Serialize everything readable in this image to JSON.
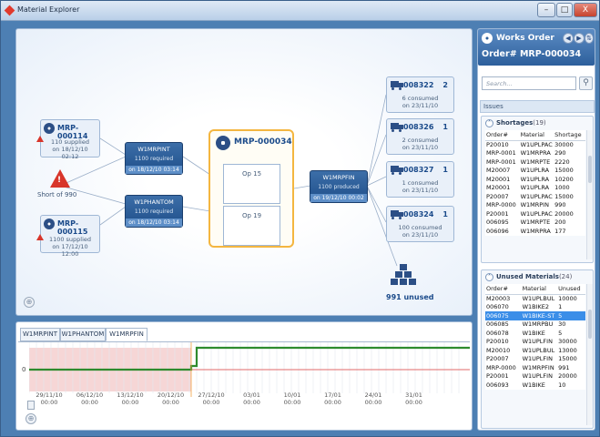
{
  "window": {
    "title": "Material Explorer",
    "buttons": [
      "–",
      "□",
      "X"
    ]
  },
  "graph": {
    "supplies": [
      {
        "id": "MRP-000114",
        "line1": "110 supplied",
        "line2": "on 18/12/10 02:12"
      },
      {
        "id": "MRP-000115",
        "line1": "1100 supplied",
        "line2": "on 17/12/10 12:00"
      }
    ],
    "shortage_label": "Short of 990",
    "requirements": [
      {
        "name": "W1MRPINT",
        "line1": "1100 required",
        "line2": "on 18/12/10 03:14"
      },
      {
        "name": "W1PHANTOM",
        "line1": "1100 required",
        "line2": "on 18/12/10 03:14"
      }
    ],
    "order": {
      "id": "MRP-000034",
      "ops": [
        "Op 15",
        "Op 19"
      ]
    },
    "produced": {
      "name": "W1MRPFIN",
      "line1": "1100 produced",
      "line2": "on 19/12/10 00:02"
    },
    "consumers": [
      {
        "id": "008322",
        "count": "2",
        "line1": "6 consumed",
        "line2": "on 23/11/10"
      },
      {
        "id": "008326",
        "count": "1",
        "line1": "2 consumed",
        "line2": "on 23/11/10"
      },
      {
        "id": "008327",
        "count": "1",
        "line1": "1 consumed",
        "line2": "on 23/11/10"
      },
      {
        "id": "008324",
        "count": "1",
        "line1": "100 consumed",
        "line2": "on 23/11/10"
      }
    ],
    "unused_label": "991 unused"
  },
  "timeline": {
    "tabs": [
      "W1MRPINT",
      "W1PHANTOM",
      "W1MRPFIN"
    ],
    "active_tab": "W1MRPFIN",
    "y_label": "0",
    "x_ticks": [
      [
        "29/11/10",
        "00:00"
      ],
      [
        "06/12/10",
        "00:00"
      ],
      [
        "13/12/10",
        "00:00"
      ],
      [
        "20/12/10",
        "00:00"
      ],
      [
        "27/12/10",
        "00:00"
      ],
      [
        "03/01",
        "00:00"
      ],
      [
        "10/01",
        "00:00"
      ],
      [
        "17/01",
        "00:00"
      ],
      [
        "24/01",
        "00:00"
      ],
      [
        "31/01",
        "00:00"
      ]
    ],
    "colors": {
      "shortage_fill": "#f6d6d6",
      "stock_line": "#2e8b2e",
      "shortage_line": "#e06a6a"
    }
  },
  "sidebar": {
    "title": "Works Order",
    "order_no": "Order# MRP-000034",
    "search_placeholder": "Search...",
    "issues_label": "Issues",
    "shortages": {
      "label": "Shortages",
      "count": "(19)",
      "headers": [
        "Order#",
        "Material",
        "Shortage"
      ],
      "rows": [
        [
          "P20010",
          "W1UPLPAC",
          "30000"
        ],
        [
          "MRP-0001",
          "W1MRPRA",
          "290"
        ],
        [
          "MRP-0001",
          "W1MRPTE",
          "2220"
        ],
        [
          "M20007",
          "W1UPLRA",
          "15000"
        ],
        [
          "M20001",
          "W1UPLRA",
          "10200"
        ],
        [
          "M20001",
          "W1UPLRA",
          "1000"
        ],
        [
          "P20007",
          "W1UPLPAC",
          "15000"
        ],
        [
          "MRP-0000",
          "W1MRPIN",
          "990"
        ],
        [
          "P20001",
          "W1UPLPAC",
          "20000"
        ],
        [
          "006095",
          "W1MRPTE",
          "200"
        ],
        [
          "006096",
          "W1MRPRA",
          "177"
        ]
      ]
    },
    "unused": {
      "label": "Unused Materials",
      "count": "(24)",
      "headers": [
        "Order#",
        "Material",
        "Unused"
      ],
      "selected_row": 2,
      "rows": [
        [
          "M20003",
          "W1UPLBUL",
          "10000"
        ],
        [
          "006070",
          "W1BIKE2",
          "1"
        ],
        [
          "006075",
          "W1BIKE-ST",
          "5"
        ],
        [
          "006085",
          "W1MRPBU",
          "30"
        ],
        [
          "006078",
          "W1BIKE",
          "5"
        ],
        [
          "P20010",
          "W1UPLFIN",
          "30000"
        ],
        [
          "M20010",
          "W1UPLBUL",
          "13000"
        ],
        [
          "P20007",
          "W1UPLFIN",
          "15000"
        ],
        [
          "MRP-0000",
          "W1MRPFIN",
          "991"
        ],
        [
          "P20001",
          "W1UPLFIN",
          "20000"
        ],
        [
          "006093",
          "W1BIKE",
          "10"
        ]
      ]
    }
  }
}
